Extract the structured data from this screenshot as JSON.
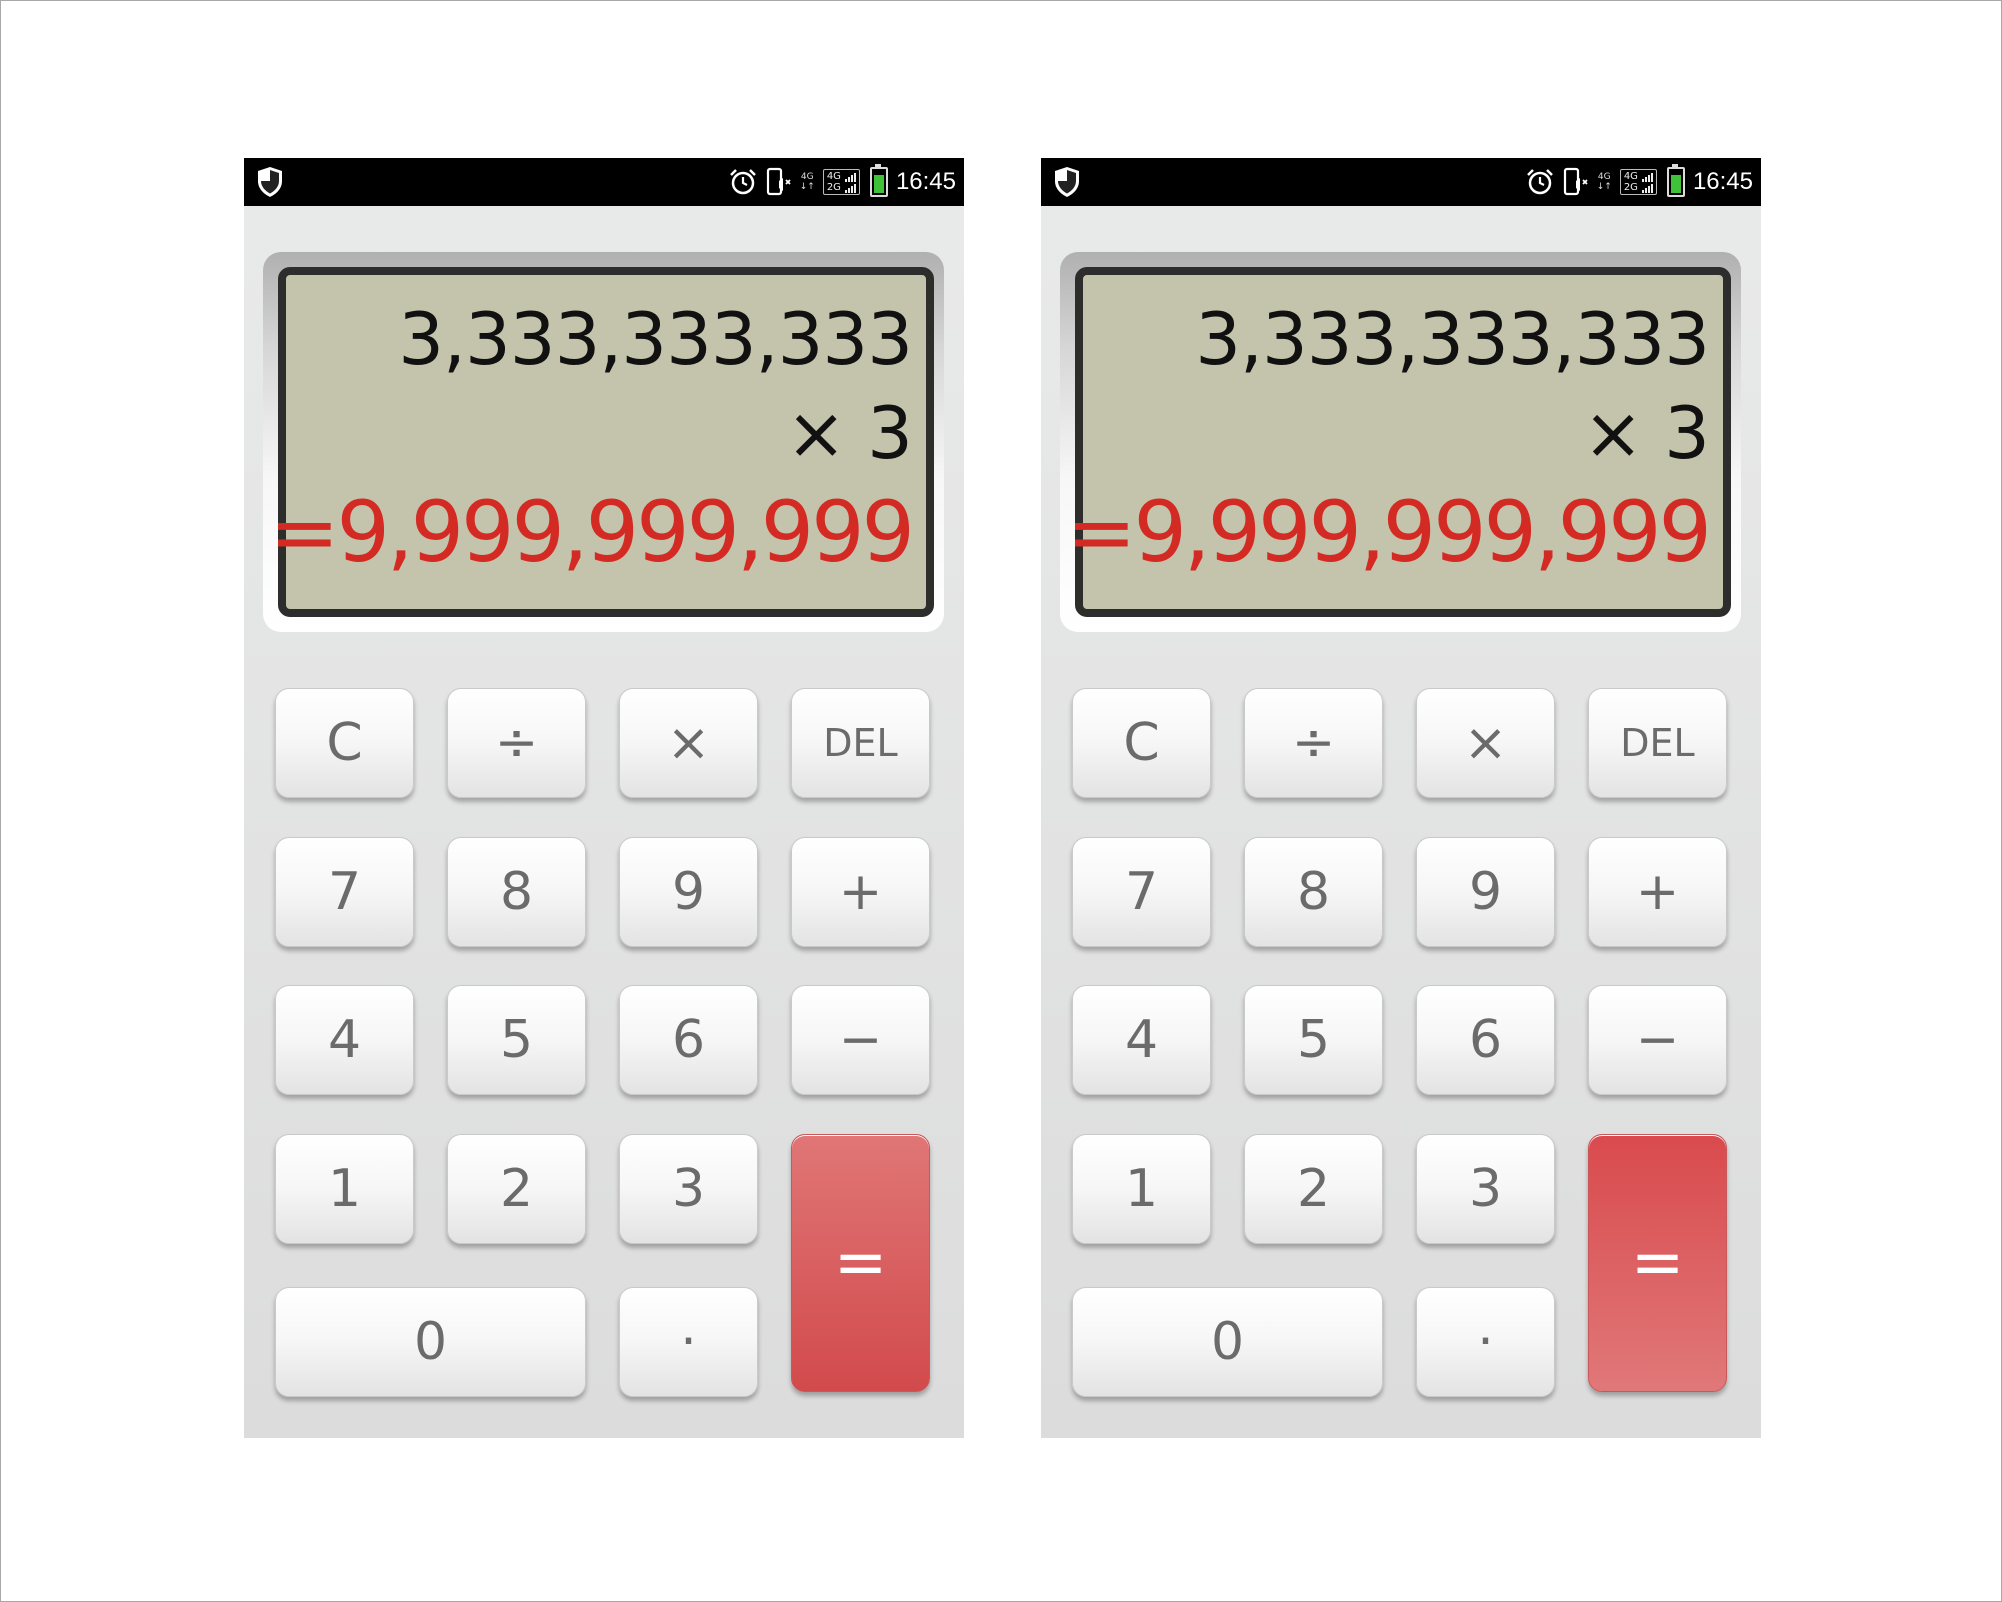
{
  "colors": {
    "lcd_bg": "#c4c3ac",
    "result": "#d42a24",
    "equals_key": "#dd5a5c"
  },
  "left": {
    "status": {
      "net_small_top": "4G",
      "net_small_bottom": "↓↑",
      "net_box_top": "4G",
      "net_box_bottom": "2G",
      "time": "16:45"
    },
    "display": {
      "operand1": "3,333,333,333",
      "operation": "× 3",
      "result": "=9,999,999,999"
    },
    "keys": {
      "clear": "C",
      "divide": "÷",
      "multiply": "×",
      "del": "DEL",
      "k7": "7",
      "k8": "8",
      "k9": "9",
      "plus": "+",
      "k4": "4",
      "k5": "5",
      "k6": "6",
      "minus": "−",
      "k1": "1",
      "k2": "2",
      "k3": "3",
      "equals": "=",
      "k0": "0",
      "dot": "·"
    }
  },
  "right": {
    "status": {
      "net_small_top": "4G",
      "net_small_bottom": "↓↑",
      "net_box_top": "4G",
      "net_box_bottom": "2G",
      "time": "16:45"
    },
    "display": {
      "operand1": "3,333,333,333",
      "operation": "× 3",
      "result": "=9,999,999,999"
    },
    "keys": {
      "clear": "C",
      "divide": "÷",
      "multiply": "×",
      "del": "DEL",
      "k7": "7",
      "k8": "8",
      "k9": "9",
      "plus": "+",
      "k4": "4",
      "k5": "5",
      "k6": "6",
      "minus": "−",
      "k1": "1",
      "k2": "2",
      "k3": "3",
      "equals": "=",
      "k0": "0",
      "dot": "·"
    }
  }
}
